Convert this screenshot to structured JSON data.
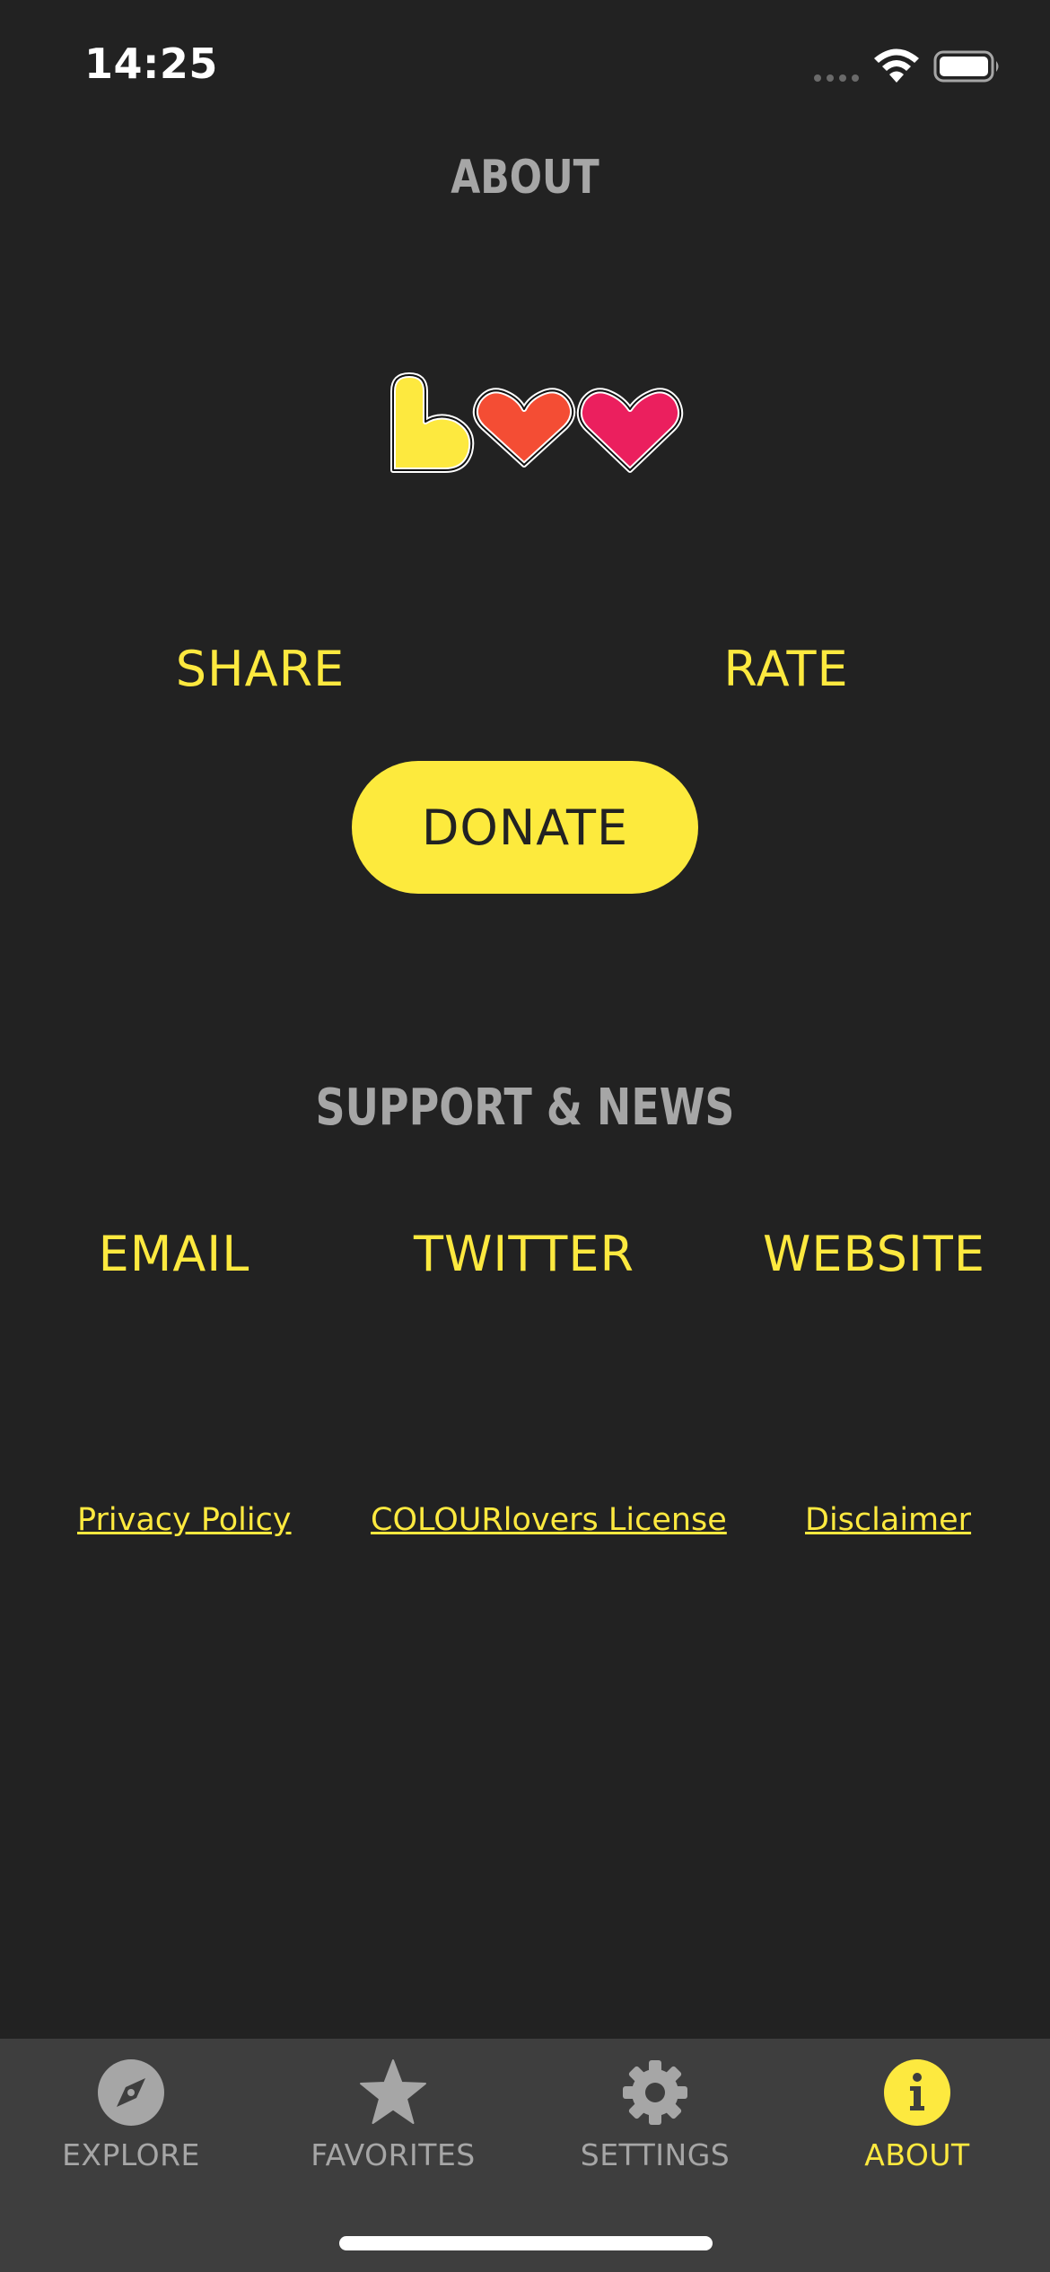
{
  "status_bar": {
    "time": "14:25",
    "icons": [
      "signal-dots-icon",
      "wifi-icon",
      "battery-icon"
    ]
  },
  "header": {
    "title": "ABOUT"
  },
  "logo": {
    "icon": "hearts-logo",
    "colors": [
      "#fde93f",
      "#f44d34",
      "#eb1f5e"
    ]
  },
  "actions": {
    "share_label": "SHARE",
    "rate_label": "RATE",
    "donate_label": "DONATE"
  },
  "support": {
    "title": "SUPPORT & NEWS",
    "email_label": "EMAIL",
    "twitter_label": "TWITTER",
    "website_label": "WEBSITE"
  },
  "legal": {
    "privacy_label": "Privacy Policy",
    "license_label": "COLOURlovers License",
    "disclaimer_label": "Disclaimer"
  },
  "tab_bar": {
    "tabs": [
      {
        "label": "EXPLORE",
        "icon": "compass-icon",
        "active": false
      },
      {
        "label": "FAVORITES",
        "icon": "star-icon",
        "active": false
      },
      {
        "label": "SETTINGS",
        "icon": "gear-icon",
        "active": false
      },
      {
        "label": "ABOUT",
        "icon": "info-icon",
        "active": true
      }
    ]
  },
  "colors": {
    "background": "#222222",
    "accent": "#fde93f",
    "muted": "#a6a6a6",
    "tab_bar": "#3e3e3e"
  }
}
